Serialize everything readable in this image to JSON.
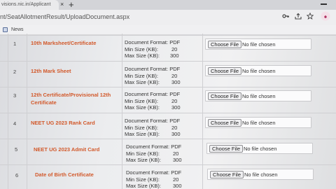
{
  "browser": {
    "tab_title": "visions.nic.in/Applicant",
    "new_tab_symbol": "+",
    "close_symbol": "×",
    "url": "nt/SeatAllotmentResult/UploadDocument.aspx",
    "bookmarks": [
      {
        "label": "News",
        "icon": "page-icon"
      }
    ]
  },
  "upload_table": {
    "choose_label": "Choose File",
    "no_file_label": "No file chosen",
    "format_label": "Document Format:",
    "min_label": "Min Size (KB):",
    "max_label": "Max Size (KB):",
    "rows": [
      {
        "sno": "1",
        "name": "10th Marksheet/Certificate",
        "format": "PDF",
        "min": "20",
        "max": "300"
      },
      {
        "sno": "2",
        "name": "12th Mark Sheet",
        "format": "PDF",
        "min": "20",
        "max": "300"
      },
      {
        "sno": "3",
        "name": "12th Certificate/Provisional 12th Certificate",
        "format": "PDF",
        "min": "20",
        "max": "300"
      },
      {
        "sno": "4",
        "name": "NEET UG 2023 Rank Card",
        "format": "PDF",
        "min": "20",
        "max": "300"
      },
      {
        "sno": "5",
        "name": "NEET UG 2023 Admit Card",
        "format": "PDF",
        "min": "20",
        "max": "300"
      },
      {
        "sno": "6",
        "name": "Date of Birth Certificate",
        "format": "PDF",
        "min": "20",
        "max": "300"
      }
    ]
  }
}
